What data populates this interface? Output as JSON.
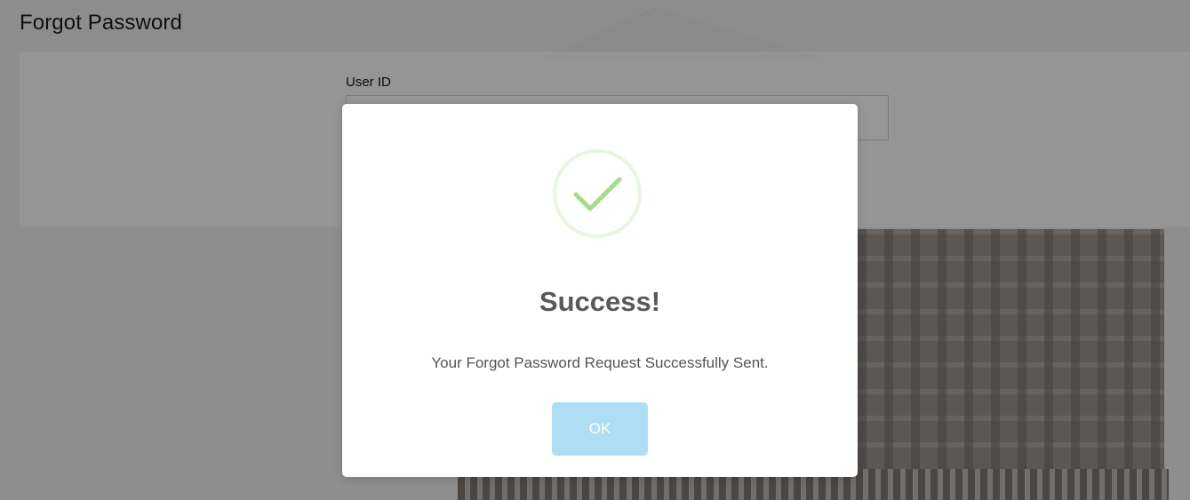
{
  "page": {
    "title": "Forgot Password"
  },
  "form": {
    "user_id_label": "User ID",
    "user_id_value": ""
  },
  "modal": {
    "icon": "checkmark-icon",
    "title": "Success!",
    "message": "Your Forgot Password Request Successfully Sent.",
    "ok_label": "OK"
  },
  "colors": {
    "success_green": "#a5dc86",
    "ok_button": "#aedef4",
    "overlay": "rgba(0,0,0,0.40)"
  }
}
